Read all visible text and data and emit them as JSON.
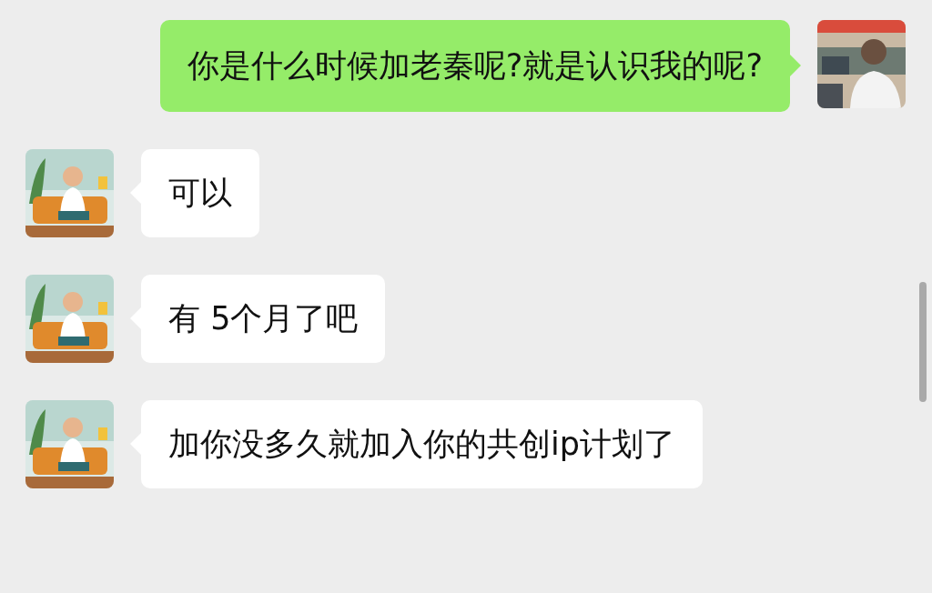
{
  "messages": [
    {
      "kind": "sent",
      "text": "你是什么时候加老秦呢?就是认识我的呢?"
    },
    {
      "kind": "received",
      "text": "可以"
    },
    {
      "kind": "received",
      "text": "有 5个月了吧"
    },
    {
      "kind": "received",
      "text": "加你没多久就加入你的共创ip计划了"
    }
  ]
}
